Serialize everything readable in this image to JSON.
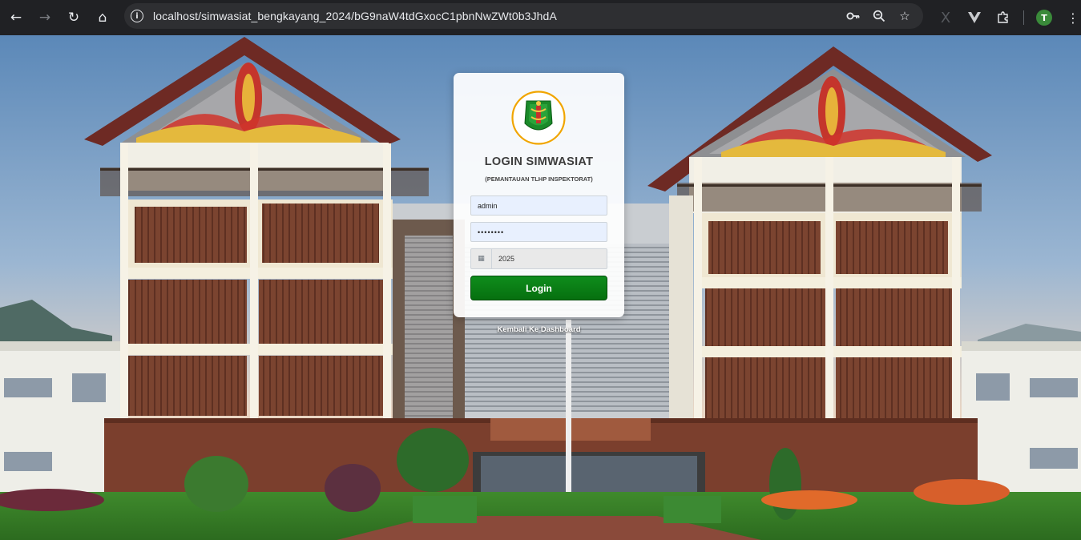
{
  "browser": {
    "url": "localhost/simwasiat_bengkayang_2024/bG9naW4tdGxocC1pbnNwZWt0b3JhdA",
    "profile_initial": "T"
  },
  "login": {
    "title": "LOGIN SIMWASIAT",
    "subtitle": "(PEMANTAUAN TLHP INSPEKTORAT)",
    "username_value": "admin",
    "password_value": "••••••••",
    "year_value": "2025",
    "login_button": "Login",
    "back_link": "Kembali Ke Dashboard"
  },
  "colors": {
    "button": "#0a7d16",
    "card": "#ffffff",
    "logo_ring": "#f0a500"
  }
}
